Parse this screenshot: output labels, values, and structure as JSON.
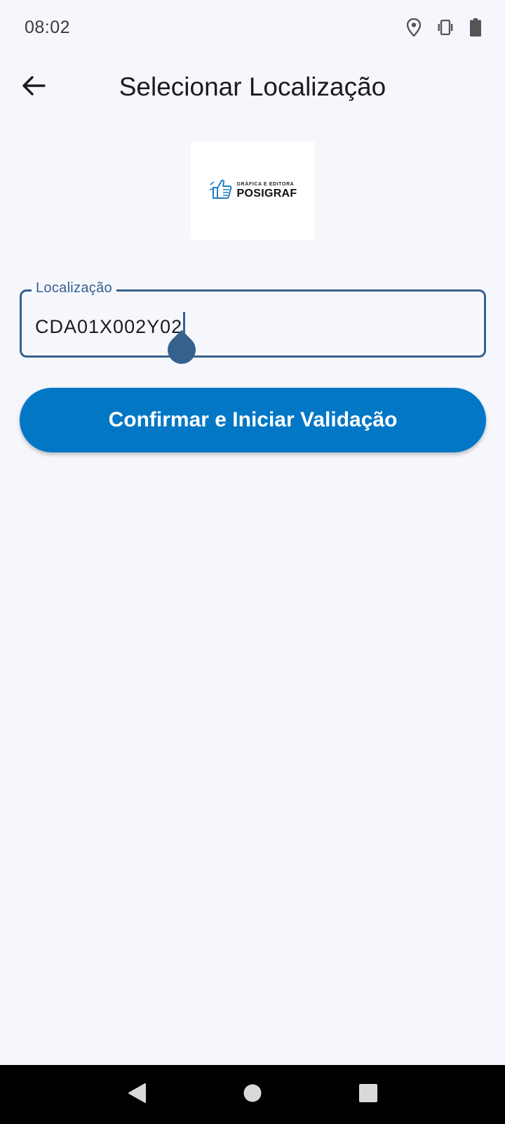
{
  "status_bar": {
    "time": "08:02",
    "icons": [
      "location-icon",
      "vibrate-icon",
      "battery-icon"
    ]
  },
  "app_bar": {
    "back_icon": "arrow-left-icon",
    "title": "Selecionar Localização"
  },
  "logo": {
    "small_text": "GRÁFICA E EDITORA",
    "brand_text": "POSIGRAF",
    "icon": "thumbs-up-icon"
  },
  "location_field": {
    "label": "Localização",
    "value": "CDA01X002Y02"
  },
  "confirm_button": {
    "label": "Confirmar e Iniciar Validação"
  },
  "nav_bar": {
    "buttons": [
      "back-triangle-icon",
      "home-circle-icon",
      "recents-square-icon"
    ]
  },
  "colors": {
    "background": "#f6f7fd",
    "primary": "#0277c6",
    "field_outline": "#36618e"
  }
}
